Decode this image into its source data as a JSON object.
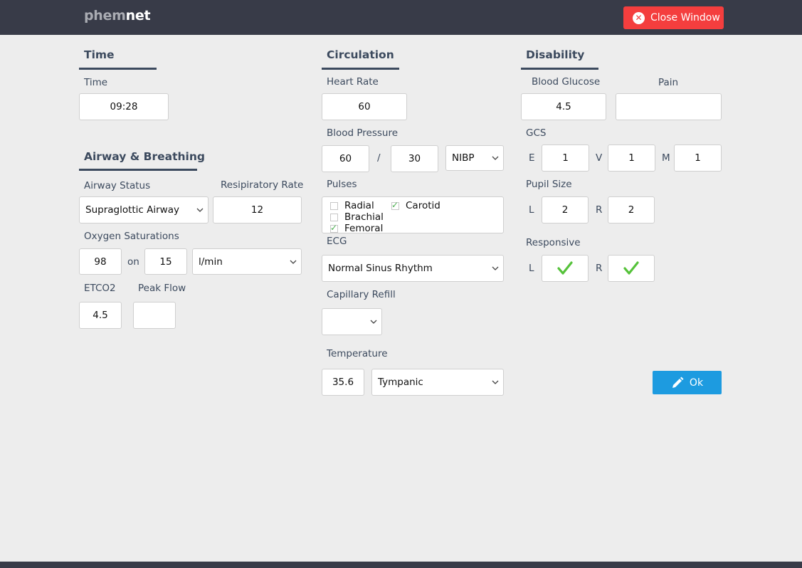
{
  "header": {
    "logo_part1": "phem",
    "logo_part2": "net",
    "close_label": "Close Window"
  },
  "time_section": {
    "title": "Time",
    "time_label": "Time",
    "time_value": "09:28"
  },
  "airway": {
    "title": "Airway & Breathing",
    "status_label": "Airway Status",
    "status_value": "Supraglottic Airway",
    "rr_label": "Resipiratory Rate",
    "rr_value": "12",
    "spo2_label": "Oxygen Saturations",
    "spo2_value": "98",
    "on_label": "on",
    "o2_flow_value": "15",
    "o2_unit_value": "l/min",
    "etco2_label": "ETCO2",
    "etco2_value": "4.5",
    "peak_flow_label": "Peak Flow",
    "peak_flow_value": ""
  },
  "circulation": {
    "title": "Circulation",
    "hr_label": "Heart Rate",
    "hr_value": "60",
    "bp_label": "Blood Pressure",
    "bp_systolic": "60",
    "bp_sep": "/",
    "bp_diastolic": "30",
    "bp_method": "NIBP",
    "pulses_label": "Pulses",
    "pulses": [
      {
        "label": "Radial",
        "checked": false
      },
      {
        "label": "Carotid",
        "checked": true
      },
      {
        "label": "Brachial",
        "checked": false
      },
      {
        "label": "Femoral",
        "checked": true
      }
    ],
    "ecg_label": "ECG",
    "ecg_value": "Normal Sinus Rhythm",
    "cap_refill_label": "Capillary Refill",
    "cap_refill_value": "",
    "temp_label": "Temperature",
    "temp_value": "35.6",
    "temp_method": "Tympanic"
  },
  "disability": {
    "title": "Disability",
    "glucose_label": "Blood Glucose",
    "glucose_value": "4.5",
    "pain_label": "Pain",
    "pain_value": "",
    "gcs_label": "GCS",
    "gcs_e_label": "E",
    "gcs_e_value": "1",
    "gcs_v_label": "V",
    "gcs_v_value": "1",
    "gcs_m_label": "M",
    "gcs_m_value": "1",
    "pupil_label": "Pupil Size",
    "pupil_l_label": "L",
    "pupil_l_value": "2",
    "pupil_r_label": "R",
    "pupil_r_value": "2",
    "responsive_label": "Responsive",
    "resp_l_label": "L",
    "resp_r_label": "R",
    "resp_l_checked": true,
    "resp_r_checked": true
  },
  "ok_label": "Ok",
  "colors": {
    "header_bg": "#383b48",
    "close_red": "#f43e3e",
    "ok_blue": "#1d9be0",
    "heading": "#3c4a5e",
    "check_green": "#4caf50"
  }
}
